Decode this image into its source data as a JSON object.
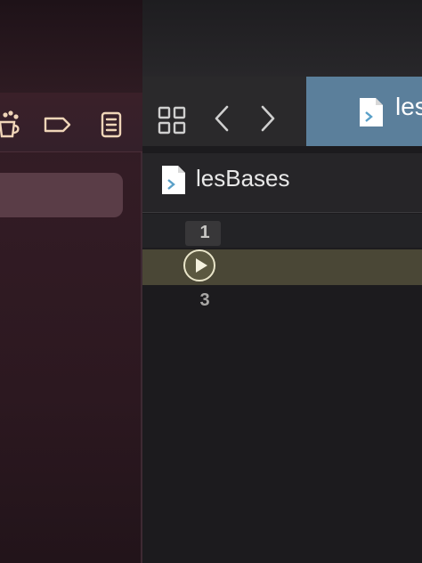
{
  "tab": {
    "label": "les"
  },
  "jumpbar": {
    "file_name": "lesBases"
  },
  "gutter": {
    "lines": [
      "1",
      "",
      "3"
    ]
  },
  "colors": {
    "active_tab": "#5b7f9b",
    "current_line": "#4a4736",
    "sidebar": "#331c25",
    "editor_bg": "#1c1b1e"
  },
  "icons": {
    "navigator": [
      "library-icon",
      "tag-icon",
      "list-icon"
    ],
    "editor": [
      "grid-icon",
      "chevron-left-icon",
      "chevron-right-icon",
      "swift-file-icon",
      "run-icon"
    ]
  }
}
